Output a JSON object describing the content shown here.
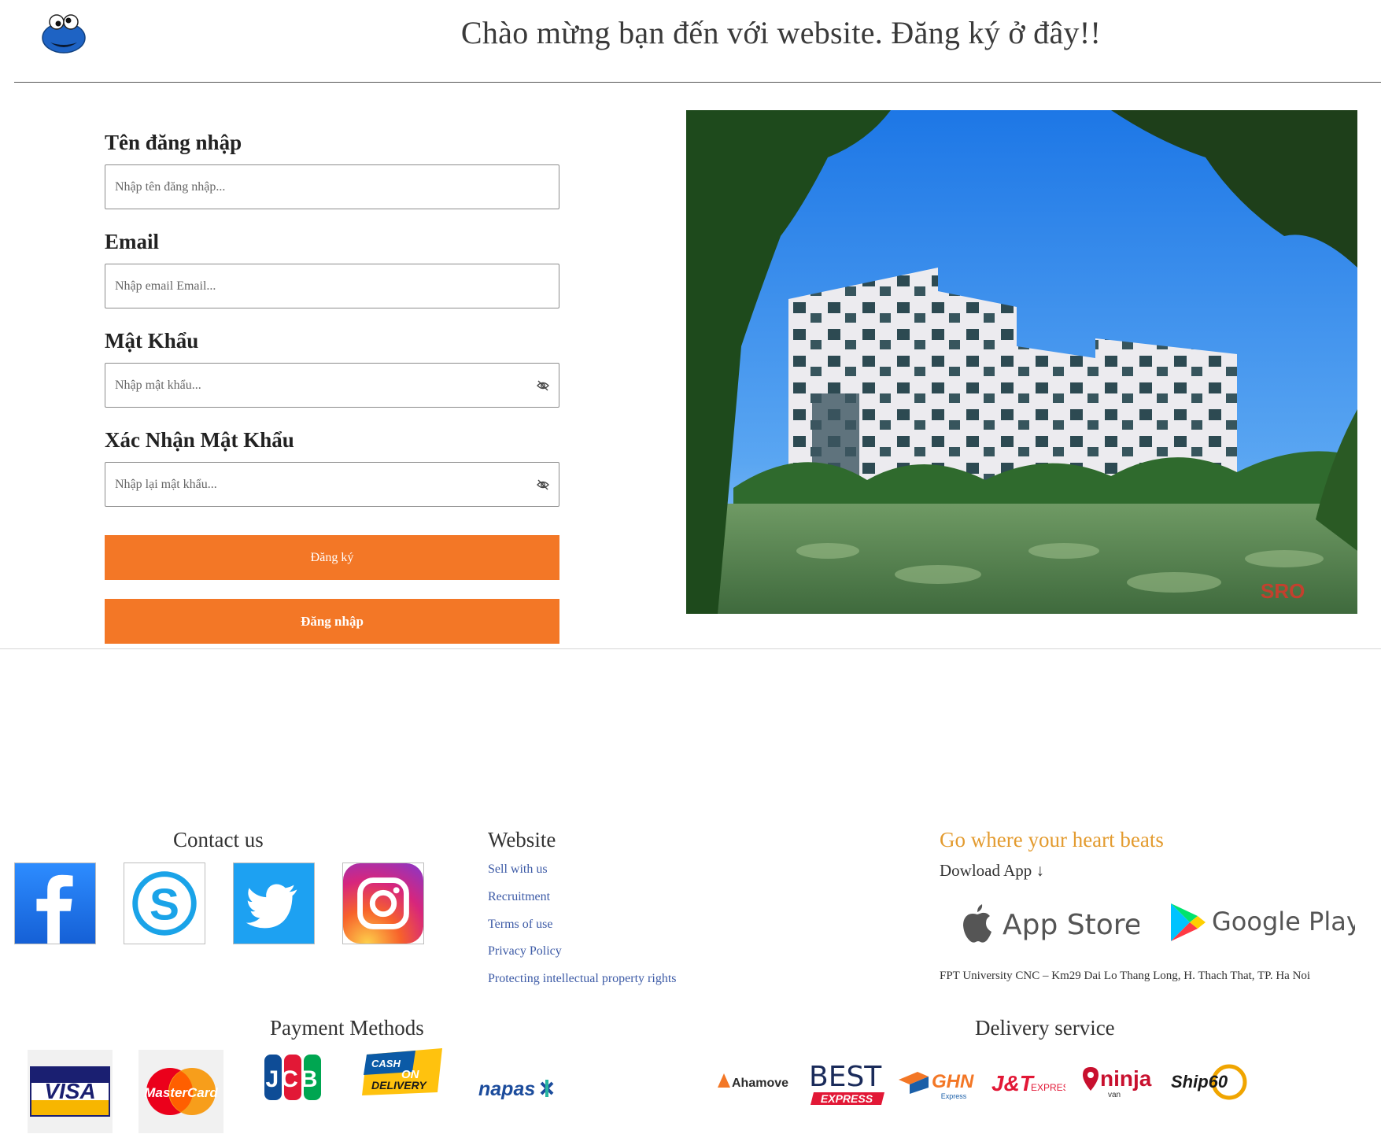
{
  "header": {
    "title": "Chào mừng bạn đến với website. Đăng ký ở đây!!"
  },
  "form": {
    "username": {
      "label": "Tên đăng nhập",
      "placeholder": "Nhập tên đăng nhập...",
      "value": ""
    },
    "email": {
      "label": "Email",
      "placeholder": "Nhập email Email...",
      "value": ""
    },
    "password": {
      "label": "Mật Khẩu",
      "placeholder": "Nhập mật khẩu...",
      "value": ""
    },
    "confirm_password": {
      "label": "Xác Nhận Mật Khẩu",
      "placeholder": "Nhập lại mật khẩu...",
      "value": ""
    },
    "register_button": "Đăng ký",
    "login_button": "Đăng nhập"
  },
  "photo": {
    "watermark": "SRO"
  },
  "footer": {
    "contact": {
      "title": "Contact us",
      "icons": [
        "facebook-icon",
        "skype-icon",
        "twitter-icon",
        "instagram-icon"
      ]
    },
    "website": {
      "title": "Website",
      "links": [
        "Sell with us",
        "Recruitment",
        "Terms of use",
        "Privacy Policy",
        "Protecting intellectual property rights"
      ]
    },
    "app": {
      "slogan": "Go where your heart beats",
      "download_label": "Dowload App",
      "download_arrow": "↓",
      "app_store": "App Store",
      "google_play": "Google Play",
      "address": "FPT University CNC – Km29 Dai Lo Thang Long, H. Thach That, TP. Ha Noi"
    },
    "payment": {
      "title": "Payment Methods",
      "visa": "VISA",
      "mastercard": "MasterCard",
      "jcb": "JCB",
      "cod_line1": "CASH",
      "cod_line2": "ON",
      "cod_line3": "DELIVERY",
      "napas": "napas"
    },
    "delivery": {
      "title": "Delivery service",
      "ahamove": "Ahamove",
      "best_line1": "BEST",
      "best_line2": "EXPRESS",
      "ghn": "GHN",
      "ghn_sub": "Express",
      "jt": "J&T",
      "jt_sub": "EXPRESS",
      "ninja": "ninja",
      "ninja_sub": "van",
      "ship60": "Ship60"
    }
  },
  "colors": {
    "accent": "#f37726",
    "slogan": "#e39b2f",
    "link": "#3c5aa6"
  }
}
